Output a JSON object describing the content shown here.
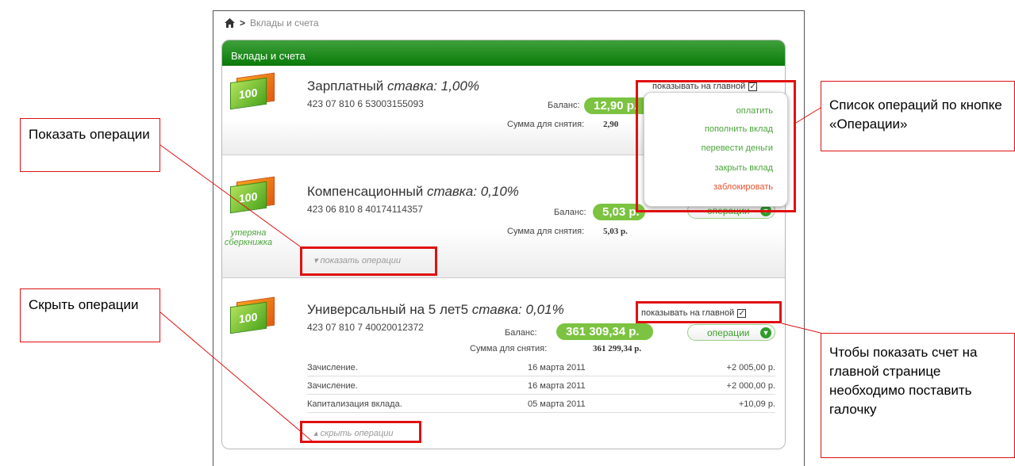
{
  "breadcrumb": {
    "home_icon": "home-icon",
    "separator": ">",
    "current": "Вклады и счета"
  },
  "panel": {
    "title": "Вклады и счета"
  },
  "accounts": [
    {
      "name": "Зарплатный",
      "rate": "ставка: 1,00%",
      "number": "423 07 810 6 53003155093",
      "balance_label": "Баланс:",
      "balance": "12,90 р.",
      "withdraw_label": "Сумма для снятия:",
      "withdraw": "2,90",
      "show_main_label": "показывать на главной"
    },
    {
      "name": "Компенсационный",
      "rate": "ставка: 0,10%",
      "number": "423 06 810 8 40174114357",
      "balance_label": "Баланс:",
      "balance": "5,03 р.",
      "withdraw_label": "Сумма для снятия:",
      "withdraw": "5,03 р.",
      "ops_label": "операции",
      "lost_label": "утеряна сберкнижка",
      "toggle_label": "показать операции"
    },
    {
      "name": "Универсальный на 5 лет5",
      "rate": "ставка: 0,01%",
      "number": "423 07 810 7 40020012372",
      "balance_label": "Баланс:",
      "balance": "361 309,34 р.",
      "withdraw_label": "Сумма для снятия:",
      "withdraw": "361 299,34 р.",
      "show_main_label": "показывать на главной",
      "ops_label": "операции",
      "toggle_label": "скрыть операции",
      "transactions": [
        {
          "desc": "Зачисление.",
          "date": "16 марта 2011",
          "amount": "+2 005,00 р."
        },
        {
          "desc": "Зачисление.",
          "date": "16 марта 2011",
          "amount": "+2 000,00 р."
        },
        {
          "desc": "Капитализация вклада.",
          "date": "05 марта 2011",
          "amount": "+10,09 р."
        }
      ]
    }
  ],
  "dropdown": {
    "items": [
      "оплатить",
      "пополнить вклад",
      "перевести деньги",
      "закрыть вклад"
    ],
    "danger_item": "заблокировать"
  },
  "callouts": {
    "show_ops": "Показать операции",
    "hide_ops": "Скрыть операции",
    "ops_list": "Список операций по кнопке «Операции»",
    "main_page": "Чтобы показать счет на главной странице необходимо поставить галочку"
  },
  "colors": {
    "accent_green": "#0a7a0a",
    "balance_green": "#7bc340",
    "danger": "#e5532d",
    "callout_red": "#e01010"
  }
}
